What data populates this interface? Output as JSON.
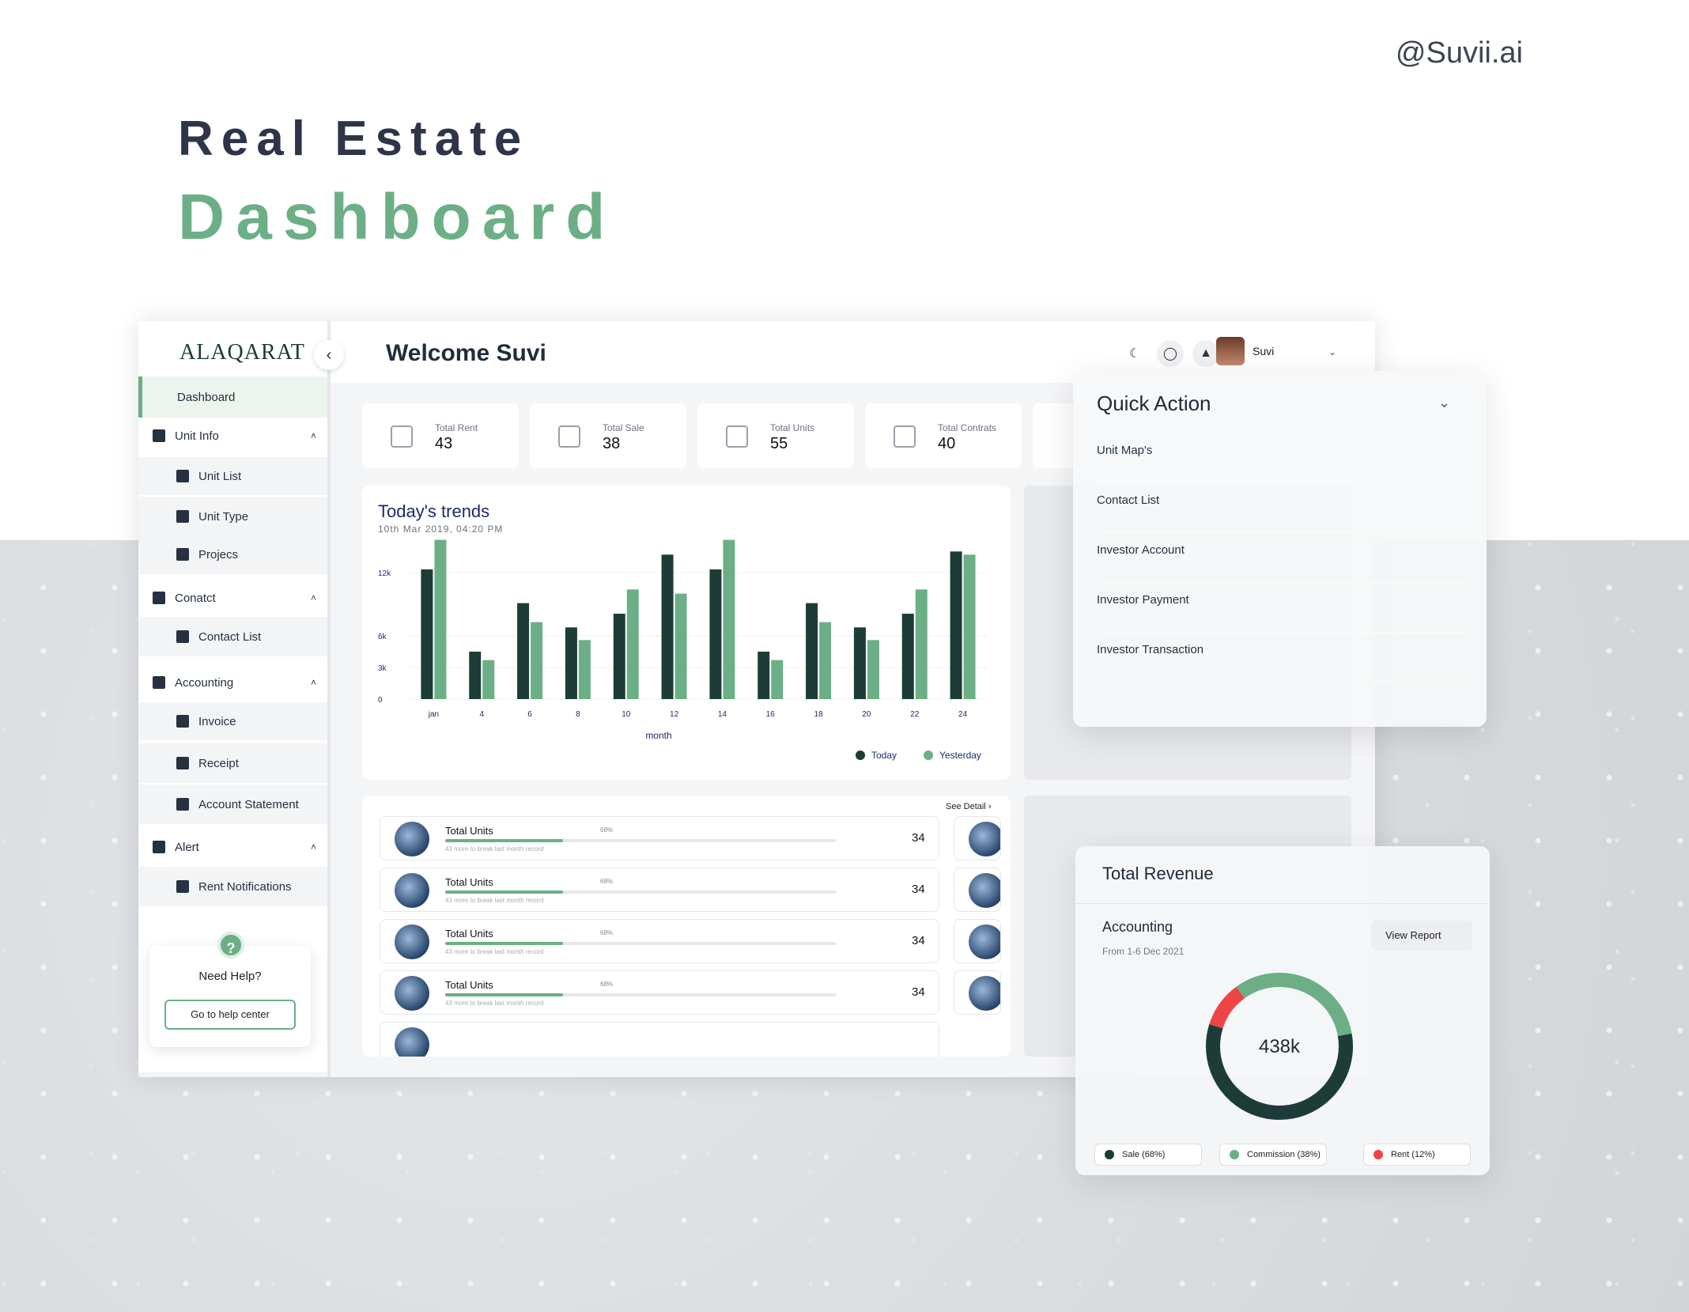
{
  "header": {
    "handle": "@Suvii.ai",
    "title_line1": "Real Estate",
    "title_line2": "Dashboard"
  },
  "sidebar": {
    "logo": "ALAQARAT",
    "items": [
      {
        "label": "Dashboard",
        "type": "active"
      },
      {
        "label": "Unit Info",
        "type": "group",
        "icon": "building-icon"
      },
      {
        "label": "Unit List",
        "type": "sub",
        "icon": "building-icon"
      },
      {
        "label": "Unit Type",
        "type": "sub",
        "icon": "card-icon"
      },
      {
        "label": "Projecs",
        "type": "sub",
        "icon": "card-icon"
      },
      {
        "label": "Conatct",
        "type": "group",
        "icon": "contact-icon"
      },
      {
        "label": "Contact List",
        "type": "sub",
        "icon": "contact-card-icon"
      },
      {
        "label": "Accounting",
        "type": "group",
        "icon": "calculator-icon"
      },
      {
        "label": "Invoice",
        "type": "sub",
        "icon": "invoice-icon"
      },
      {
        "label": "Receipt",
        "type": "sub",
        "icon": "credit-card-icon"
      },
      {
        "label": "Account Statement",
        "type": "sub",
        "icon": "statement-icon"
      },
      {
        "label": "Alert",
        "type": "group",
        "icon": "bell-icon"
      },
      {
        "label": "Rent Notifications",
        "type": "sub",
        "icon": "bell-icon"
      },
      {
        "label": "Investor Account",
        "type": "sub",
        "icon": "card-icon"
      }
    ],
    "help": {
      "question_mark": "?",
      "title": "Need Help?",
      "button": "Go to help center"
    }
  },
  "topbar": {
    "welcome": "Welcome Suvi",
    "user_name": "Suvi"
  },
  "stats": [
    {
      "label": "Total Rent",
      "value": "43"
    },
    {
      "label": "Total Sale",
      "value": "38"
    },
    {
      "label": "Total Units",
      "value": "55"
    },
    {
      "label": "Total Contrats",
      "value": "40"
    }
  ],
  "chart_data": {
    "type": "bar",
    "title": "Today's trends",
    "subtitle": "10th Mar 2019, 04:20 PM",
    "xlabel": "month",
    "ylabel": "",
    "categories": [
      "jan",
      "4",
      "6",
      "8",
      "10",
      "12",
      "14",
      "16",
      "18",
      "20",
      "22",
      "24"
    ],
    "yticks": [
      "0",
      "3k",
      "6k",
      "12k"
    ],
    "ylim": [
      0,
      15000
    ],
    "series": [
      {
        "name": "Today",
        "color": "#1d3c38",
        "values": [
          12300,
          4500,
          9100,
          6800,
          8100,
          13700,
          12300,
          4500,
          9100,
          6800,
          8100,
          14000
        ]
      },
      {
        "name": "Yesterday",
        "color": "#6caf86",
        "values": [
          15100,
          3700,
          7300,
          5600,
          10400,
          10000,
          15100,
          3700,
          7300,
          5600,
          10400,
          13700
        ]
      }
    ],
    "legend_position": "bottom-right"
  },
  "list": {
    "see_detail": "See Detail",
    "rows": [
      {
        "label": "Total Units",
        "percent": "68%",
        "progress": 0.3,
        "sub": "43 more to break last month record",
        "value": "34"
      },
      {
        "label": "Total Units",
        "percent": "68%",
        "progress": 0.3,
        "sub": "43 more to break last month record",
        "value": "34"
      },
      {
        "label": "Total Units",
        "percent": "68%",
        "progress": 0.3,
        "sub": "43 more to break last month record",
        "value": "34"
      },
      {
        "label": "Total Units",
        "percent": "68%",
        "progress": 0.3,
        "sub": "43 more to break last month record",
        "value": "34"
      }
    ]
  },
  "quick_action": {
    "title": "Quick Action",
    "items": [
      "Unit Map's",
      "Contact List",
      "Investor Account",
      "Investor Payment",
      "Investor Transaction"
    ]
  },
  "revenue": {
    "title": "Total Revenue",
    "subtitle": "Accounting",
    "range": "From 1-6 Dec 2021",
    "button": "View Report",
    "total": "438k",
    "segments": [
      {
        "label": "Sale (68%)",
        "value": 68,
        "color": "#1d3c38"
      },
      {
        "label": "Commission (38%)",
        "value": 38,
        "color": "#6caf86"
      },
      {
        "label": "Rent (12%)",
        "value": 12,
        "color": "#ef4444"
      }
    ]
  }
}
